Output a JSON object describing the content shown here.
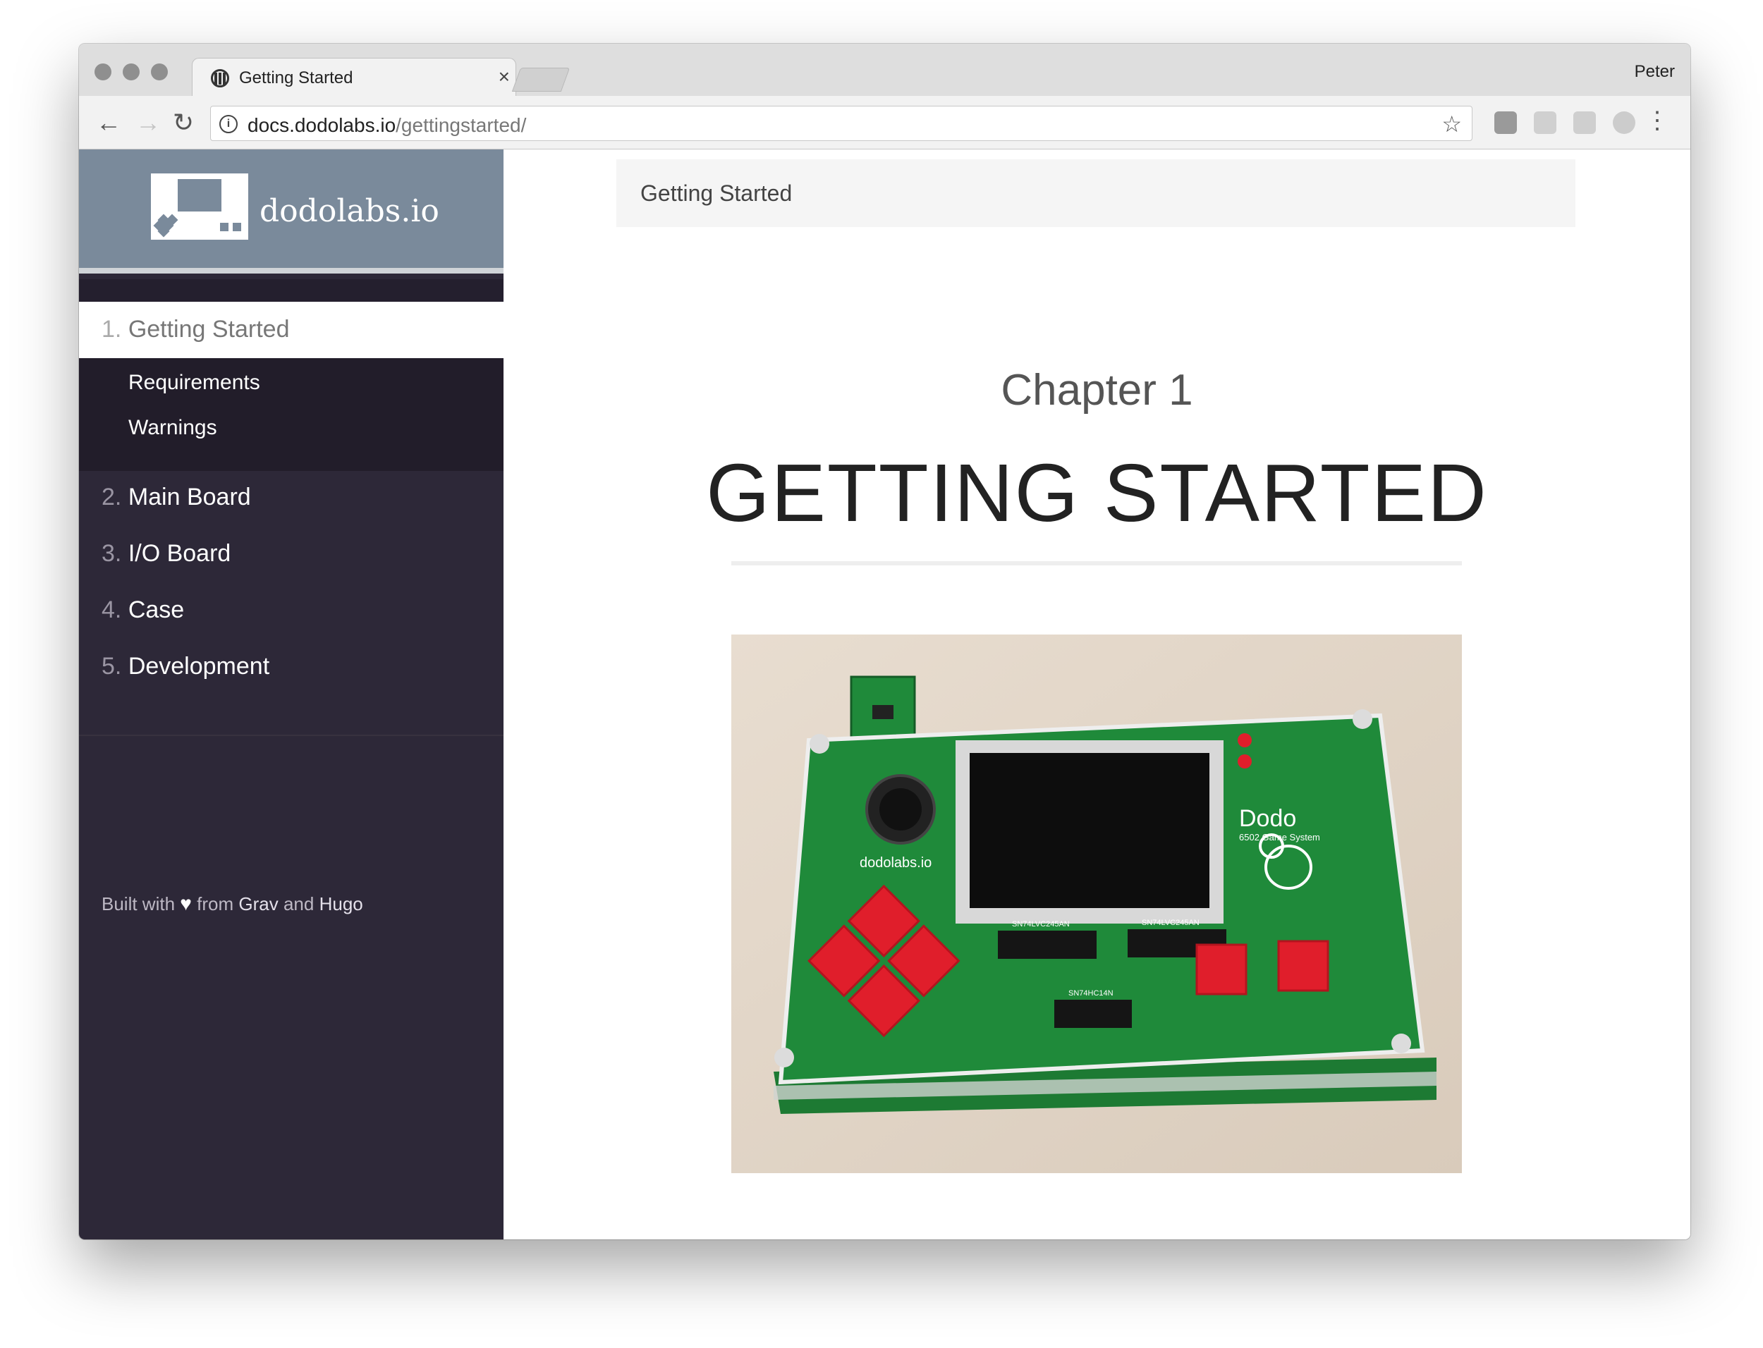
{
  "browser": {
    "tab_title": "Getting Started",
    "tab_close": "×",
    "profile_name": "Peter",
    "url_host": "docs.dodolabs.io",
    "url_path": "/gettingstarted/",
    "back_icon": "←",
    "forward_icon": "→",
    "reload_icon": "↻",
    "info_icon": "i",
    "star_icon": "☆",
    "menu_icon": "⋮"
  },
  "sidebar": {
    "brand": "dodolabs.io",
    "active_item": {
      "number": "1.",
      "label": "Getting Started"
    },
    "sub_items": [
      {
        "label": "Requirements"
      },
      {
        "label": "Warnings"
      }
    ],
    "items": [
      {
        "number": "2.",
        "label": "Main Board"
      },
      {
        "number": "3.",
        "label": "I/O Board"
      },
      {
        "number": "4.",
        "label": "Case"
      },
      {
        "number": "5.",
        "label": "Development"
      }
    ],
    "footer": {
      "prefix": "Built with",
      "heart": "♥",
      "middle": "from",
      "link1": "Grav",
      "and": "and",
      "link2": "Hugo"
    }
  },
  "content": {
    "breadcrumb": "Getting Started",
    "chapter_label": "Chapter 1",
    "title": "GETTING STARTED",
    "photo": {
      "board_brand": "dodolabs.io",
      "board_name": "Dodo",
      "board_subtitle": "6502 Game System",
      "chip_1": "SN74LVC245AN",
      "chip_2": "SN74LVC245AN",
      "chip_3": "SN74HC14N"
    }
  },
  "colors": {
    "sidebar_bg": "#2d2838",
    "brand_bg": "#7a8a9b",
    "accent_arrow": "#00aee8",
    "board_green": "#1f8a3a",
    "button_red": "#e01e2b"
  }
}
